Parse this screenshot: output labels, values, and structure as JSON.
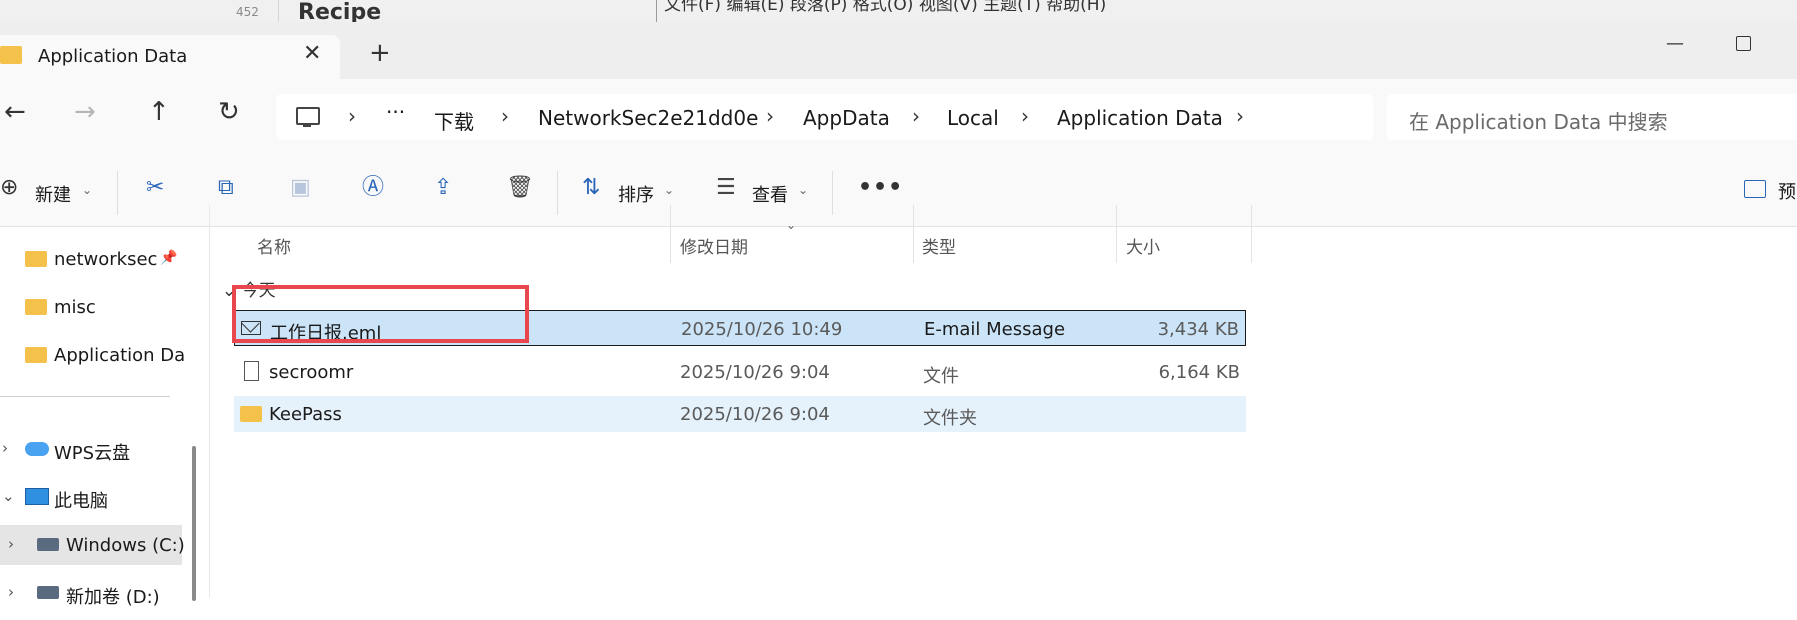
{
  "background_window": {
    "line_number": "452",
    "title": "Recipe",
    "menu": "文件(F)   编辑(E)   段落(P)   格式(O)   视图(V)   主题(T)   帮助(H)"
  },
  "tab": {
    "title": "Application Data",
    "close": "✕",
    "add": "+"
  },
  "window": {
    "minimize": "—"
  },
  "nav": {
    "back": "←",
    "forward": "→",
    "up": "↑",
    "refresh": "↻"
  },
  "address": {
    "more": "···",
    "segments": [
      "下载",
      "NetworkSec2e21dd0e",
      "AppData",
      "Local",
      "Application Data"
    ],
    "chevron": "›"
  },
  "search": {
    "placeholder": "在 Application Data 中搜索"
  },
  "toolbar": {
    "new_label": "新建",
    "sort_label": "排序",
    "view_label": "查看",
    "more": "•••",
    "preview_label": "预"
  },
  "sidebar": {
    "quick": [
      {
        "label": "networksec",
        "pinned": true
      },
      {
        "label": "misc"
      },
      {
        "label": "Application Da"
      }
    ],
    "locations": [
      {
        "label": "WPS云盘",
        "icon": "cloud-icon"
      },
      {
        "label": "此电脑",
        "icon": "computer-icon"
      },
      {
        "label": "Windows (C:)",
        "icon": "drive-icon"
      },
      {
        "label": "新加卷 (D:)",
        "icon": "drive-icon"
      }
    ]
  },
  "columns": [
    "名称",
    "修改日期",
    "类型",
    "大小"
  ],
  "group_label": "今天",
  "files": [
    {
      "name": "工作日报.eml",
      "date": "2025/10/26 10:49",
      "type": "E-mail Message",
      "size": "3,434 KB",
      "icon": "mail-icon",
      "selected": true
    },
    {
      "name": "secroomr",
      "date": "2025/10/26 9:04",
      "type": "文件",
      "size": "6,164 KB",
      "icon": "file-icon"
    },
    {
      "name": "KeePass",
      "date": "2025/10/26 9:04",
      "type": "文件夹",
      "size": "",
      "icon": "folder-icon"
    }
  ],
  "colors": {
    "accent": "#2a66b8",
    "selection": "#cce4f7",
    "highlight_box": "#e8474d",
    "folder": "#f4c24a"
  }
}
